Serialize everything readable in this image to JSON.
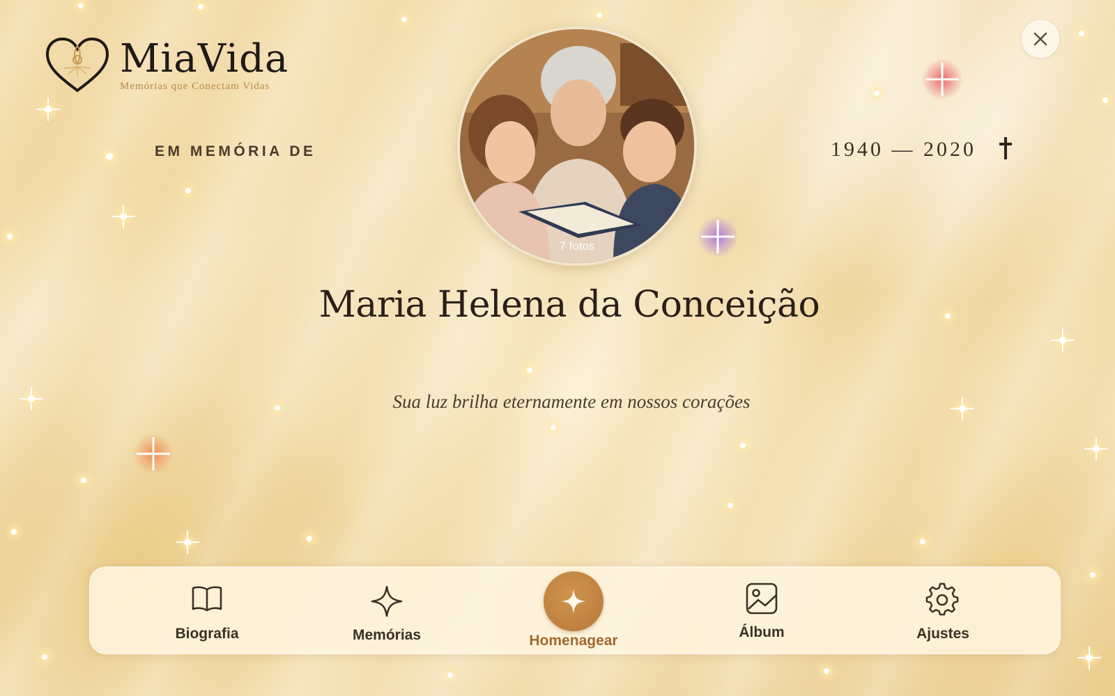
{
  "brand": {
    "name": "MiaVida",
    "tagline": "Memórias que Conectam Vidas"
  },
  "memorial": {
    "label": "EM MEMÓRIA DE",
    "years": "1940 — 2020",
    "name": "Maria Helena da Conceição",
    "epitaph": "Sua luz brilha eternamente em nossos corações",
    "photo_count": "7 fotos"
  },
  "icons": {
    "close": "close-icon",
    "cross": "cross-icon",
    "logo": "heart-icon"
  },
  "nav": {
    "items": [
      {
        "label": "Biografia",
        "icon": "book-icon",
        "active": false
      },
      {
        "label": "Memórias",
        "icon": "sparkle-icon",
        "active": false
      },
      {
        "label": "Homenagear",
        "icon": "star-icon",
        "active": true
      },
      {
        "label": "Álbum",
        "icon": "image-icon",
        "active": false
      },
      {
        "label": "Ajustes",
        "icon": "gear-icon",
        "active": false
      }
    ]
  },
  "colors": {
    "accent": "#b8783a",
    "active_label": "#a2692d",
    "text_dark": "#2b2018"
  }
}
